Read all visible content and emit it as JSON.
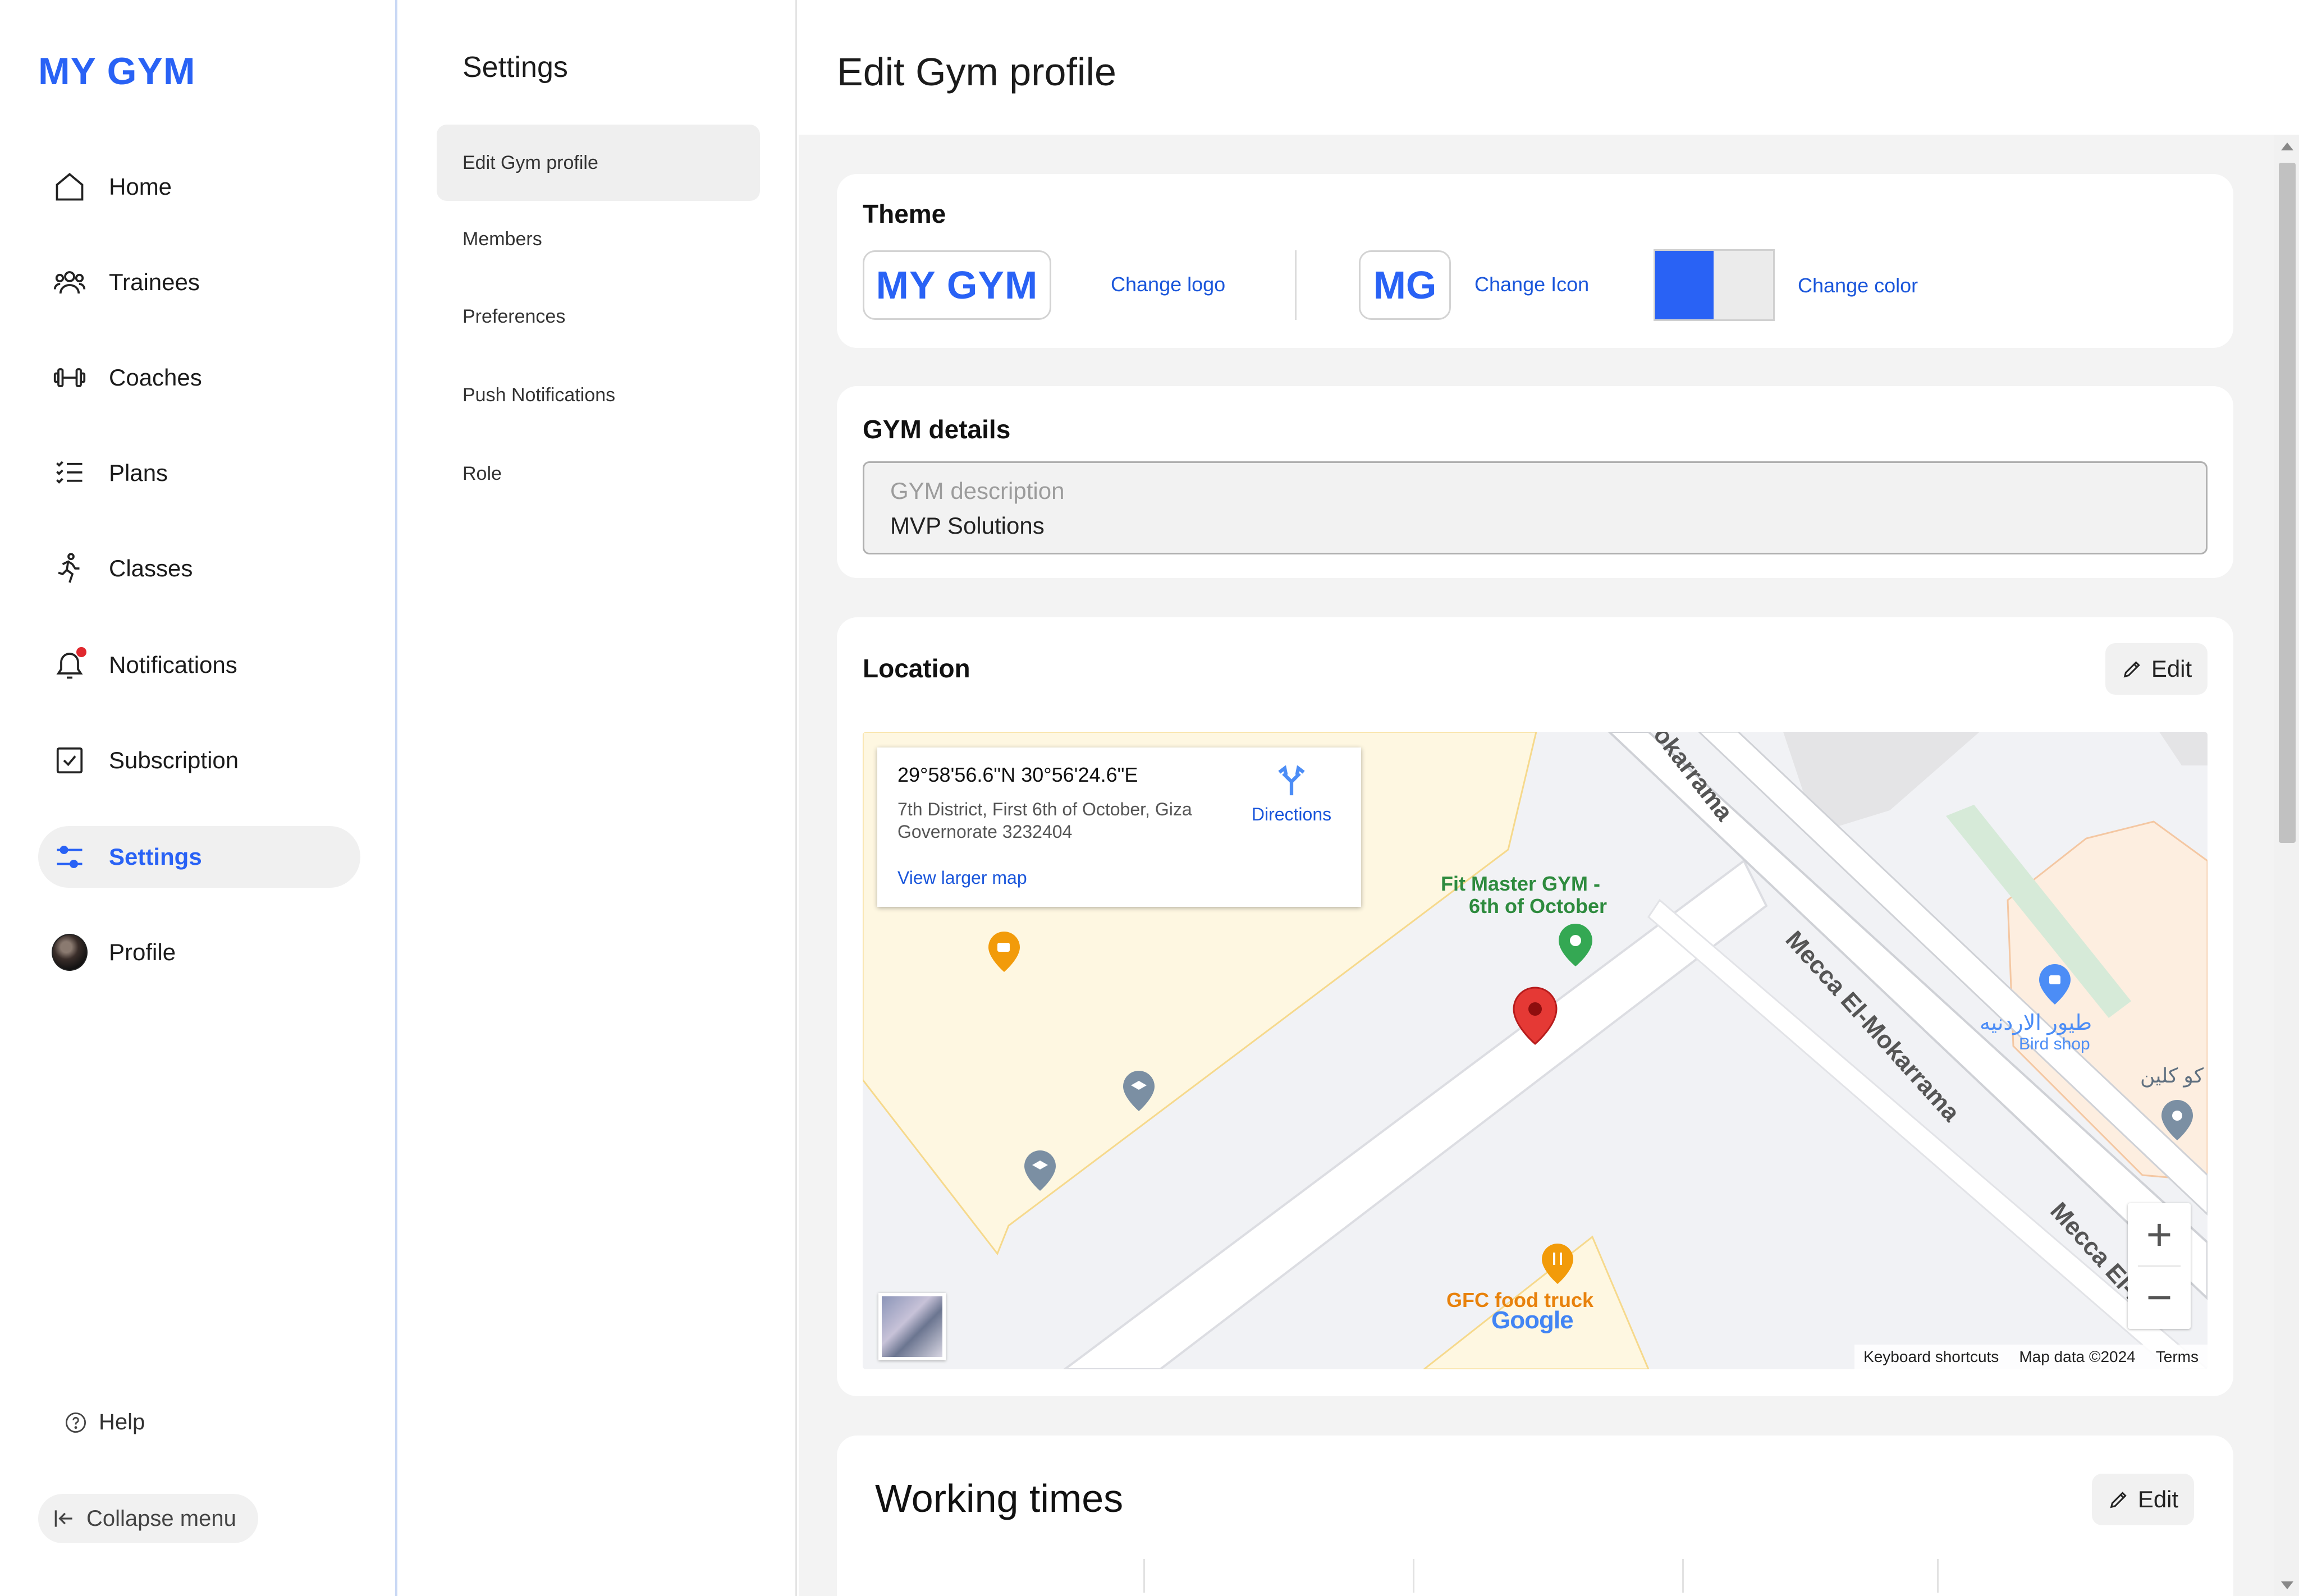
{
  "app": {
    "brand": "MY GYM"
  },
  "sidebar": {
    "items": [
      {
        "label": "Home",
        "icon": "home-icon"
      },
      {
        "label": "Trainees",
        "icon": "users-icon"
      },
      {
        "label": "Coaches",
        "icon": "dumbbell-icon"
      },
      {
        "label": "Plans",
        "icon": "checklist-icon"
      },
      {
        "label": "Classes",
        "icon": "running-icon"
      },
      {
        "label": "Notifications",
        "icon": "bell-icon"
      },
      {
        "label": "Subscription",
        "icon": "checkbox-icon"
      },
      {
        "label": "Settings",
        "icon": "sliders-icon",
        "active": true
      },
      {
        "label": "Profile",
        "icon": "avatar"
      }
    ],
    "help": "Help",
    "collapse": "Collapse menu"
  },
  "settings": {
    "title": "Settings",
    "items": [
      {
        "label": "Edit Gym profile",
        "active": true
      },
      {
        "label": "Members"
      },
      {
        "label": "Preferences"
      },
      {
        "label": "Push Notifications"
      },
      {
        "label": "Role"
      }
    ]
  },
  "main": {
    "title": "Edit Gym profile",
    "theme": {
      "title": "Theme",
      "logo_text": "MY GYM",
      "change_logo": "Change logo",
      "icon_text": "MG",
      "change_icon": "Change Icon",
      "change_color": "Change color",
      "primary_color": "#2962f5",
      "secondary_color": "#ebebeb"
    },
    "details": {
      "title": "GYM details",
      "description_label": "GYM description",
      "description_value": "MVP Solutions"
    },
    "location": {
      "title": "Location",
      "edit": "Edit",
      "map": {
        "coords": "29°58'56.6\"N 30°56'24.6\"E",
        "address": "7th District, First 6th of October, Giza Governorate 3232404",
        "view_larger": "View larger map",
        "directions": "Directions",
        "place_gym": "Fit Master GYM -",
        "place_gym_2": "6th of October",
        "street_1": "Mecca El-Mokarrama",
        "street_2": "Mecca El-Mo",
        "street_3": "okarrama",
        "bird_shop_ar": "طيور الاردنيه",
        "bird_shop": "Bird shop",
        "ar_label": "كو كلين",
        "food_truck": "GFC food truck",
        "google": "Google",
        "keyboard": "Keyboard shortcuts",
        "map_data": "Map data ©2024",
        "terms": "Terms",
        "zoom_in": "+",
        "zoom_out": "−"
      }
    },
    "working_times": {
      "title": "Working times",
      "edit": "Edit"
    }
  }
}
